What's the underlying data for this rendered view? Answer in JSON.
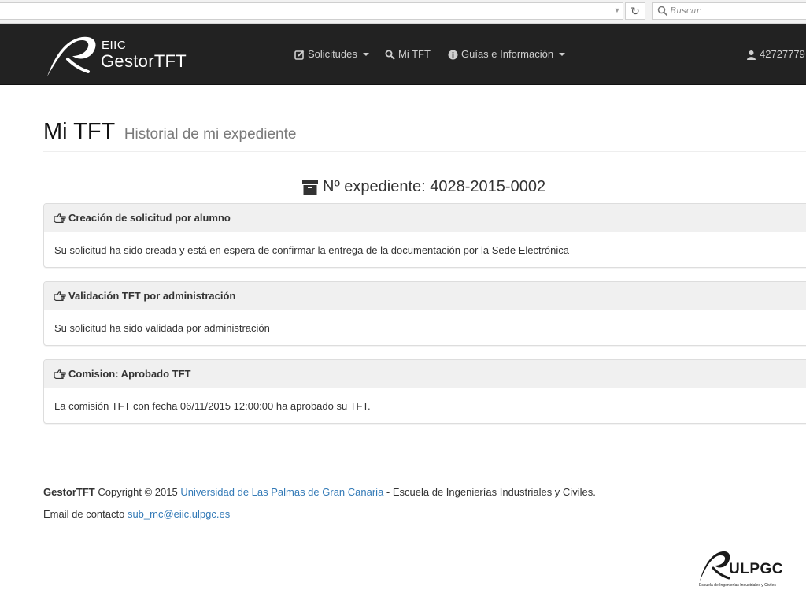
{
  "browser": {
    "search_placeholder": "Buscar"
  },
  "navbar": {
    "logo_small": "EIIC",
    "logo_name": "GestorTFT",
    "items": [
      {
        "label": "Solicitudes",
        "icon": "edit-icon",
        "dropdown": true
      },
      {
        "label": "Mi TFT",
        "icon": "search-icon",
        "dropdown": false
      },
      {
        "label": "Guías e Información",
        "icon": "info-icon",
        "dropdown": true
      }
    ],
    "user": "42727779"
  },
  "page": {
    "title": "Mi TFT",
    "subtitle": "Historial de mi expediente",
    "expediente": "Nº expediente: 4028-2015-0002"
  },
  "panels": [
    {
      "title": "Creación de solicitud por alumno",
      "body": "Su solicitud ha sido creada y está en espera de confirmar la entrega de la documentación por la Sede Electrónica"
    },
    {
      "title": "Validación TFT por administración",
      "body": "Su solicitud ha sido validada por administración"
    },
    {
      "title": "Comision: Aprobado TFT",
      "body": "La comisión TFT con fecha 06/11/2015 12:00:00 ha aprobado su TFT."
    }
  ],
  "footer": {
    "brand": "GestorTFT",
    "copyright": " Copyright © 2015 ",
    "university_link": "Universidad de Las Palmas de Gran Canaria",
    "school": " - Escuela de Ingenierías Industriales y Civiles.",
    "email_label": "Email de contacto ",
    "email": "sub_mc@eiic.ulpgc.es"
  },
  "bottom_logo": {
    "word": "ULPGC",
    "subtitle": "Escuela de Ingenierías Industriales y Civiles"
  },
  "colors": {
    "navbar_bg": "#222222",
    "link": "#337ab7",
    "panel_header": "#f0f0f0"
  }
}
